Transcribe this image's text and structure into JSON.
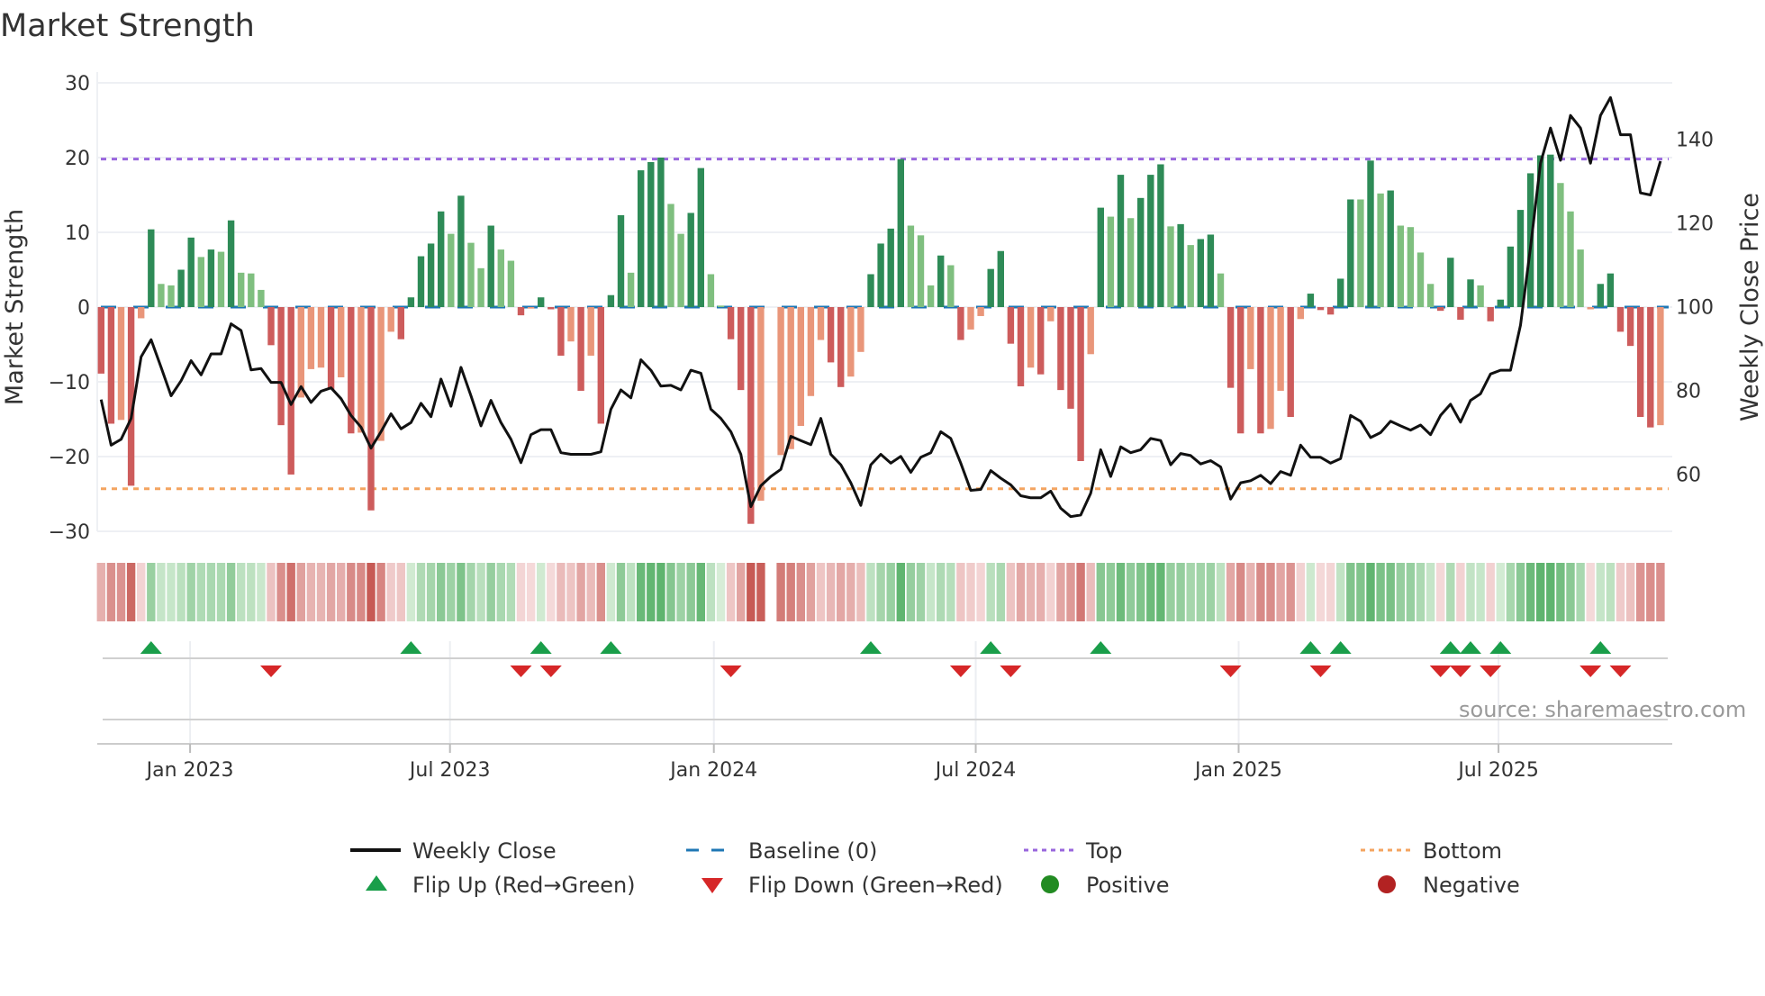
{
  "title": "Market Strength",
  "source": "source: sharemaestro.com",
  "colors": {
    "strong_green": "#2e8b57",
    "weak_green": "#7fbf7f",
    "strong_red": "#cd5c5c",
    "weak_red": "#e9967a",
    "close": "#111111",
    "baseline": "#1f77b4",
    "top": "#9966dd",
    "bottom": "#f4a460",
    "flip_up": "#1a9e4a",
    "flip_down": "#d62728",
    "positive": "#228b22",
    "negative": "#b22222"
  },
  "chart_data": {
    "type": "bar",
    "title": "Market Strength",
    "ylabel": "Market Strength",
    "y2label": "Weekly Close Price",
    "ylim": [
      -30,
      30
    ],
    "y2lim": [
      46.3,
      153.5
    ],
    "yticks": [
      "30",
      "20",
      "10",
      "0",
      "−10",
      "−20",
      "−30"
    ],
    "ytick_values": [
      30,
      20,
      10,
      0,
      -10,
      -20,
      -30
    ],
    "y2ticks": [
      "140",
      "120",
      "100",
      "80",
      "60"
    ],
    "y2tick_values": [
      140,
      120,
      100,
      80,
      60
    ],
    "x_unit": "week index (weekly bars, first bar early Nov 2022)",
    "xticks": [
      {
        "label": "Jan 2023",
        "week": 8.9
      },
      {
        "label": "Jul 2023",
        "week": 34.9
      },
      {
        "label": "Jan 2024",
        "week": 61.3
      },
      {
        "label": "Jul 2024",
        "week": 87.5
      },
      {
        "label": "Jan 2025",
        "week": 113.8
      },
      {
        "label": "Jul 2025",
        "week": 139.8
      }
    ],
    "top_level": 19.8,
    "bottom_level": -24.3,
    "baseline": 0,
    "strength": [
      -8.9,
      -15.6,
      -15.1,
      -23.9,
      -1.5,
      10.4,
      3.1,
      2.9,
      5.0,
      9.3,
      6.7,
      7.7,
      7.4,
      11.6,
      4.6,
      4.5,
      2.3,
      -5.1,
      -15.8,
      -22.4,
      -12.1,
      -8.3,
      -8.1,
      -11.0,
      -9.4,
      -16.9,
      -16.8,
      -27.2,
      -17.9,
      -3.3,
      -4.3,
      1.3,
      6.8,
      8.5,
      12.8,
      9.8,
      14.9,
      8.6,
      5.2,
      10.9,
      7.7,
      6.2,
      -1.1,
      -0.2,
      1.3,
      -0.3,
      -6.5,
      -4.6,
      -11.2,
      -6.5,
      -15.6,
      1.6,
      12.3,
      4.6,
      18.3,
      19.4,
      20.0,
      13.8,
      9.8,
      12.6,
      18.6,
      4.4,
      0.2,
      -4.3,
      -11.1,
      -29.0,
      -25.9,
      null,
      -19.8,
      -19.0,
      -15.9,
      -11.9,
      -4.4,
      -7.4,
      -10.7,
      -9.3,
      -6.0,
      4.4,
      8.5,
      10.5,
      19.8,
      10.9,
      9.6,
      2.9,
      6.9,
      5.6,
      -4.4,
      -3.0,
      -1.2,
      5.1,
      7.5,
      -4.9,
      -10.6,
      -8.1,
      -9.0,
      -1.9,
      -11.1,
      -13.6,
      -20.6,
      -6.3,
      13.3,
      12.1,
      17.7,
      11.9,
      14.6,
      17.7,
      19.1,
      10.8,
      11.1,
      8.3,
      9.1,
      9.7,
      4.5,
      -10.8,
      -16.9,
      -8.3,
      -16.9,
      -16.3,
      -11.2,
      -14.7,
      -1.6,
      1.8,
      -0.4,
      -1.0,
      3.8,
      14.4,
      14.4,
      19.6,
      15.2,
      15.6,
      10.9,
      10.7,
      7.3,
      3.1,
      -0.5,
      6.6,
      -1.7,
      3.7,
      2.9,
      -1.9,
      1.0,
      8.1,
      13.0,
      17.9,
      20.3,
      20.4,
      16.6,
      12.8,
      7.7,
      -0.3,
      3.1,
      4.5,
      -3.3,
      -5.2,
      -14.7,
      -16.1,
      -15.8
    ],
    "strong": [
      1,
      1,
      0,
      1,
      0,
      1,
      0,
      0,
      1,
      1,
      0,
      1,
      0,
      1,
      0,
      0,
      0,
      1,
      1,
      1,
      0,
      0,
      0,
      1,
      0,
      1,
      0,
      1,
      0,
      0,
      1,
      1,
      1,
      1,
      1,
      0,
      1,
      0,
      0,
      1,
      0,
      0,
      1,
      0,
      1,
      1,
      1,
      0,
      1,
      0,
      1,
      1,
      1,
      0,
      1,
      1,
      1,
      0,
      0,
      1,
      1,
      0,
      0,
      1,
      1,
      1,
      0,
      0,
      0,
      0,
      0,
      0,
      0,
      1,
      1,
      0,
      0,
      1,
      1,
      1,
      1,
      0,
      0,
      0,
      1,
      0,
      1,
      0,
      0,
      1,
      1,
      1,
      1,
      0,
      1,
      0,
      1,
      1,
      1,
      0,
      1,
      0,
      1,
      0,
      1,
      1,
      1,
      0,
      1,
      0,
      1,
      1,
      0,
      1,
      1,
      0,
      1,
      0,
      0,
      1,
      0,
      1,
      1,
      1,
      1,
      1,
      0,
      1,
      0,
      1,
      0,
      0,
      0,
      0,
      1,
      1,
      1,
      1,
      0,
      1,
      1,
      1,
      1,
      1,
      1,
      1,
      0,
      0,
      0,
      0,
      1,
      1,
      1,
      1,
      1,
      1,
      0
    ],
    "weekly_close": [
      77.8,
      66.9,
      68.3,
      73.3,
      88.0,
      92.1,
      85.5,
      78.7,
      82.3,
      87.1,
      83.7,
      88.7,
      88.7,
      95.9,
      94.3,
      84.9,
      85.2,
      81.9,
      81.9,
      76.6,
      80.9,
      77.1,
      79.8,
      80.6,
      78.0,
      74.0,
      71.2,
      66.2,
      70.1,
      74.4,
      70.8,
      72.3,
      76.9,
      73.7,
      82.7,
      76.2,
      85.5,
      78.7,
      71.5,
      77.6,
      72.3,
      68.3,
      62.7,
      69.4,
      70.6,
      70.6,
      65.1,
      64.7,
      64.7,
      64.7,
      65.3,
      75.5,
      80.1,
      78.2,
      87.3,
      84.8,
      81.0,
      81.2,
      80.1,
      84.8,
      84.1,
      75.5,
      73.3,
      70.1,
      64.7,
      52.2,
      57.2,
      59.4,
      61.1,
      69.0,
      68.0,
      67.0,
      73.3,
      64.7,
      62.2,
      57.9,
      52.5,
      62.2,
      64.7,
      62.6,
      64.2,
      60.4,
      64.0,
      65.1,
      70.1,
      68.5,
      62.6,
      56.1,
      56.3,
      60.8,
      59.0,
      57.4,
      54.8,
      54.3,
      54.3,
      55.9,
      51.8,
      49.8,
      50.2,
      55.4,
      65.8,
      59.4,
      66.5,
      65.1,
      65.8,
      68.5,
      68.0,
      62.2,
      64.9,
      64.4,
      62.4,
      63.2,
      61.7,
      54.0,
      57.9,
      58.4,
      59.7,
      57.7,
      60.6,
      59.7,
      66.9,
      64.0,
      64.0,
      62.6,
      63.7,
      74.0,
      72.6,
      68.7,
      69.9,
      72.6,
      71.5,
      70.5,
      71.7,
      69.4,
      74.0,
      76.7,
      72.4,
      77.6,
      79.2,
      83.9,
      84.8,
      84.8,
      95.6,
      114.2,
      134.3,
      142.7,
      135.0,
      145.7,
      142.7,
      134.3,
      145.7,
      150.0,
      141.1,
      141.1,
      127.2,
      126.7,
      134.8
    ],
    "flip_up_weeks": [
      5,
      31,
      44,
      51,
      77,
      89,
      100,
      121,
      124,
      135,
      137,
      140,
      150
    ],
    "flip_down_weeks": [
      17,
      42,
      45,
      63,
      86,
      91,
      113,
      122,
      134,
      136,
      139,
      149,
      152
    ],
    "legend": {
      "placement": "bottom",
      "entries": [
        {
          "label": "Weekly Close",
          "symbol": "line"
        },
        {
          "label": "Baseline (0)",
          "symbol": "dashed"
        },
        {
          "label": "Top",
          "symbol": "dotted-top"
        },
        {
          "label": "Bottom",
          "symbol": "dotted-bottom"
        },
        {
          "label": "Flip Up (Red→Green)",
          "symbol": "triangle-up"
        },
        {
          "label": "Flip Down (Green→Red)",
          "symbol": "triangle-down"
        },
        {
          "label": "Positive",
          "symbol": "circle-positive"
        },
        {
          "label": "Negative",
          "symbol": "circle-negative"
        }
      ]
    }
  }
}
